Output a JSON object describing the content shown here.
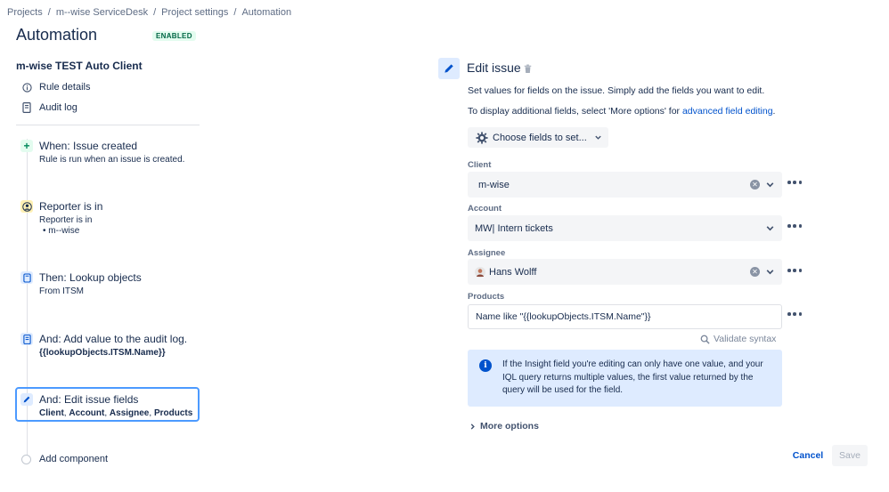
{
  "breadcrumb": {
    "items": [
      "Projects",
      "m--wise ServiceDesk",
      "Project settings",
      "Automation"
    ],
    "separator": "/"
  },
  "header": {
    "title": "Automation",
    "status": "ENABLED"
  },
  "sidebar": {
    "rule_name": "m-wise TEST Auto Client",
    "links": [
      {
        "label": "Rule details",
        "icon": "info-icon"
      },
      {
        "label": "Audit log",
        "icon": "document-icon"
      }
    ],
    "components": [
      {
        "title": "When: Issue created",
        "subtitle": "Rule is run when an issue is created.",
        "icon": "plus-icon"
      },
      {
        "title": "Reporter is in",
        "subtitle": "Reporter is in",
        "bullet": "m--wise",
        "icon": "person-icon"
      },
      {
        "title": "Then: Lookup objects",
        "subtitle": "From ITSM",
        "icon": "database-icon"
      },
      {
        "title": "And: Add value to the audit log.",
        "subtitle": "{{lookupObjects.ITSM.Name}}",
        "icon": "audit-log-icon"
      },
      {
        "title": "And: Edit issue fields",
        "fields": [
          "Client",
          "Account",
          "Assignee",
          "Products"
        ],
        "separator": ", ",
        "icon": "pencil-icon"
      }
    ],
    "add_component": "Add component"
  },
  "panel": {
    "title": "Edit issue",
    "desc1": "Set values for fields on the issue. Simply add the fields you want to edit.",
    "desc2_prefix": "To display additional fields, select 'More options' for ",
    "desc2_link": "advanced field editing",
    "desc2_suffix": ".",
    "choose_fields": "Choose fields to set...",
    "fields": {
      "client": {
        "label": "Client",
        "value": "m-wise"
      },
      "account": {
        "label": "Account",
        "value": "MW| Intern tickets"
      },
      "assignee": {
        "label": "Assignee",
        "value": "Hans Wolff"
      },
      "products": {
        "label": "Products",
        "value": "Name like \"{{lookupObjects.ITSM.Name\"}}"
      }
    },
    "validate": "Validate syntax",
    "info": "If the Insight field you're editing can only have one value, and your IQL query returns multiple values, the first value returned by the query will be used for the field.",
    "more_options": "More options",
    "cancel": "Cancel",
    "save": "Save"
  },
  "colors": {
    "accent": "#0052cc",
    "selected_border": "#4c9aff",
    "enabled_bg": "#e3fcef",
    "enabled_text": "#006644",
    "info_bg": "#deebff"
  }
}
